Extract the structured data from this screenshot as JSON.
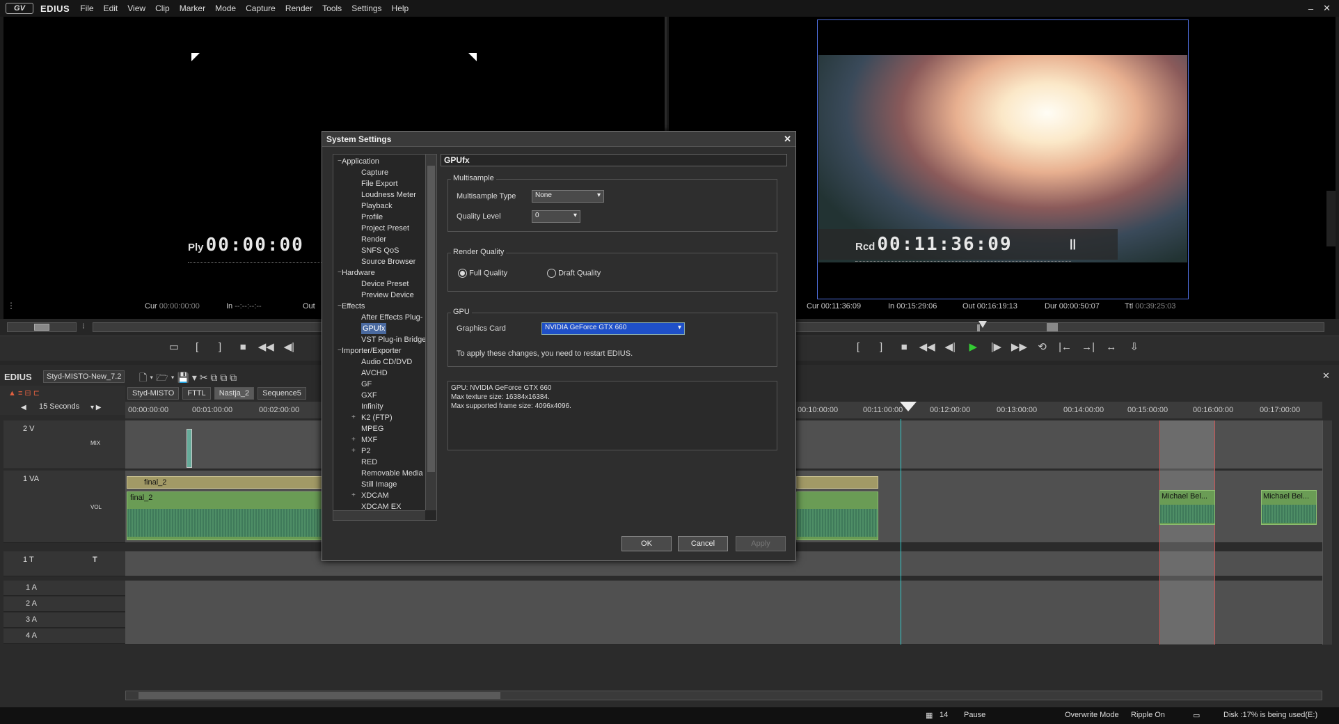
{
  "app": {
    "logo": "GV",
    "name": "EDIUS"
  },
  "menu": [
    "File",
    "Edit",
    "View",
    "Clip",
    "Marker",
    "Mode",
    "Capture",
    "Render",
    "Tools",
    "Settings",
    "Help"
  ],
  "window_controls": {
    "minimize": "–",
    "close": "✕"
  },
  "player": {
    "label": "Ply",
    "timecode": "00:00:00",
    "cur_label": "Cur",
    "cur_value": "00:00:00:00",
    "in_label": "In",
    "in_value": "--:--:--:--",
    "out_label": "Out"
  },
  "recorder": {
    "label": "Rcd",
    "timecode": "00:11:36:09",
    "pause_icon": "||",
    "cur_label": "Cur",
    "cur_value": "00:11:36:09",
    "in_label": "In",
    "in_value": "00:15:29:06",
    "out_label": "Out",
    "out_value": "00:16:19:13",
    "dur_label": "Dur",
    "dur_value": "00:00:50:07",
    "ttl_label": "Ttl",
    "ttl_value": "00:39:25:03",
    "scrub_position": 0.56
  },
  "timeline": {
    "project_label": "EDIUS",
    "project_name": "Styd-MISTO-New_7.2",
    "sequences": [
      "Styd-MISTO",
      "FTTL",
      "Nastja_2",
      "Sequence5"
    ],
    "active_sequence": "Nastja_2",
    "zoom": "15 Seconds",
    "ruler_ticks": [
      "00:00:00:00",
      "00:01:00:00",
      "00:02:00:00",
      "00:10:00:00",
      "00:11:00:00",
      "00:12:00:00",
      "00:13:00:00",
      "00:14:00:00",
      "00:15:00:00",
      "00:16:00:00",
      "00:17:00:00"
    ],
    "tracks": [
      {
        "name": "2 V",
        "tag": "MIX"
      },
      {
        "name": "1 VA",
        "tag": "VOL"
      },
      {
        "name": "1 T",
        "tag": "T"
      },
      {
        "name": "1 A"
      },
      {
        "name": "2 A"
      },
      {
        "name": "3 A"
      },
      {
        "name": "4 A"
      }
    ],
    "clips": {
      "video_left": "final_2",
      "audio_left": "final_2",
      "right_1": "Michael Bel...",
      "right_2": "Michael Bel..."
    }
  },
  "dialog": {
    "title": "System Settings",
    "close": "✕",
    "tree": [
      {
        "label": "Application",
        "level": 0,
        "expander": "−"
      },
      {
        "label": "Capture",
        "level": 1
      },
      {
        "label": "File Export",
        "level": 1
      },
      {
        "label": "Loudness Meter",
        "level": 1
      },
      {
        "label": "Playback",
        "level": 1
      },
      {
        "label": "Profile",
        "level": 1
      },
      {
        "label": "Project Preset",
        "level": 1
      },
      {
        "label": "Render",
        "level": 1
      },
      {
        "label": "SNFS QoS",
        "level": 1
      },
      {
        "label": "Source Browser",
        "level": 1
      },
      {
        "label": "Hardware",
        "level": 0,
        "expander": "−"
      },
      {
        "label": "Device Preset",
        "level": 1
      },
      {
        "label": "Preview Device",
        "level": 1
      },
      {
        "label": "Effects",
        "level": 0,
        "expander": "−"
      },
      {
        "label": "After Effects Plug-",
        "level": 1
      },
      {
        "label": "GPUfx",
        "level": 1,
        "selected": true
      },
      {
        "label": "VST Plug-in Bridge",
        "level": 1
      },
      {
        "label": "Importer/Exporter",
        "level": 0,
        "expander": "−"
      },
      {
        "label": "Audio CD/DVD",
        "level": 1
      },
      {
        "label": "AVCHD",
        "level": 1
      },
      {
        "label": "GF",
        "level": 1
      },
      {
        "label": "GXF",
        "level": 1
      },
      {
        "label": "Infinity",
        "level": 1
      },
      {
        "label": "K2 (FTP)",
        "level": 1,
        "expander": "+"
      },
      {
        "label": "MPEG",
        "level": 1
      },
      {
        "label": "MXF",
        "level": 1,
        "expander": "+"
      },
      {
        "label": "P2",
        "level": 1,
        "expander": "+"
      },
      {
        "label": "RED",
        "level": 1
      },
      {
        "label": "Removable Media",
        "level": 1
      },
      {
        "label": "Still Image",
        "level": 1
      },
      {
        "label": "XDCAM",
        "level": 1,
        "expander": "+"
      },
      {
        "label": "XDCAM EX",
        "level": 1
      }
    ],
    "panel_title": "GPUfx",
    "multisample": {
      "group": "Multisample",
      "type_label": "Multisample Type",
      "type_value": "None",
      "quality_label": "Quality Level",
      "quality_value": "0"
    },
    "render_quality": {
      "group": "Render Quality",
      "full": "Full Quality",
      "draft": "Draft Quality",
      "selected": "full"
    },
    "gpu": {
      "group": "GPU",
      "card_label": "Graphics Card",
      "card_value": "NVIDIA GeForce GTX 660",
      "note": "To apply these changes, you need to restart EDIUS."
    },
    "gpu_info": [
      "GPU: NVIDIA GeForce GTX 660",
      "Max texture size: 16384x16384.",
      "Max supported frame size: 4096x4096."
    ],
    "buttons": {
      "ok": "OK",
      "cancel": "Cancel",
      "apply": "Apply"
    }
  },
  "status": {
    "frames": "14",
    "state": "Pause",
    "mode": "Overwrite Mode",
    "ripple": "Ripple On",
    "disk": "Disk :17% is being used(E:)"
  }
}
